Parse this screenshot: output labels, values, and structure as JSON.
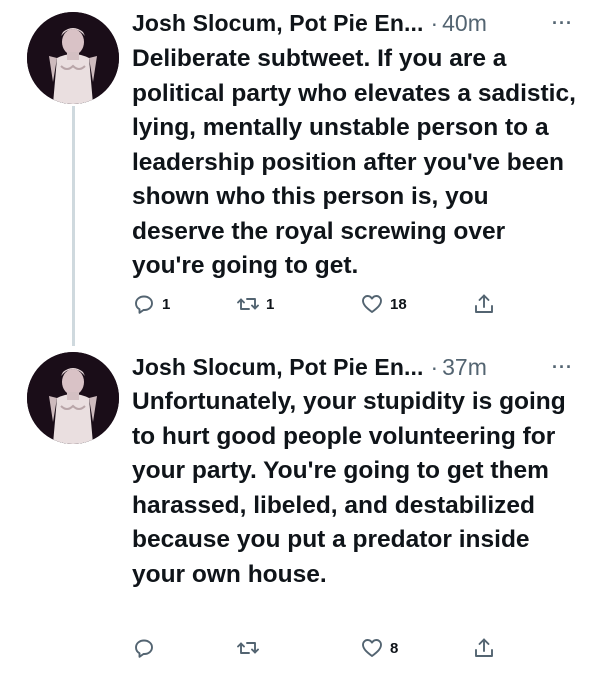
{
  "tweets": [
    {
      "author": "Josh Slocum, Pot Pie En...",
      "separator": "·",
      "time": "40m",
      "more": "···",
      "text": "Deliberate subtweet. If you are a political party who elevates a sadistic, lying, mentally unstable person to a leadership position after you've been shown who this person is, you deserve the royal screwing over you're going to get.",
      "replies": "1",
      "retweets": "1",
      "likes": "18"
    },
    {
      "author": "Josh Slocum, Pot Pie En...",
      "separator": "·",
      "time": "37m",
      "more": "···",
      "text": "Unfortunately, your stupidity is going to hurt good people volunteering for your party. You're going to get them harassed, libeled, and destabilized because you put a predator inside your own house.",
      "replies": "",
      "retweets": "",
      "likes": "8"
    }
  ],
  "icons": {
    "reply": "reply-bubble-icon",
    "retweet": "retweet-arrows-icon",
    "like": "heart-icon",
    "share": "share-upload-icon",
    "more": "more-dots-icon"
  },
  "colors": {
    "text": "#0f1419",
    "muted": "#536471",
    "thread_line": "#cfd9de"
  }
}
